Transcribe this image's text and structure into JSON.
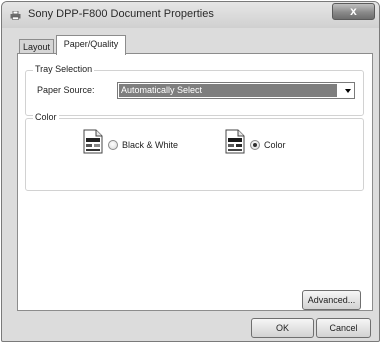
{
  "window": {
    "title": "Sony DPP-F800 Document Properties",
    "close_glyph": "x",
    "app_icon": "printer-icon"
  },
  "tabs": [
    {
      "label": "Layout",
      "selected": false
    },
    {
      "label": "Paper/Quality",
      "selected": true
    }
  ],
  "tray": {
    "group_title": "Tray Selection",
    "source_label": "Paper Source:",
    "source_value": "Automatically Select"
  },
  "color": {
    "group_title": "Color",
    "options": [
      {
        "label": "Black & White",
        "selected": false,
        "icon": "bw-document-icon"
      },
      {
        "label": "Color",
        "selected": true,
        "icon": "color-document-icon"
      }
    ]
  },
  "buttons": {
    "advanced": "Advanced...",
    "ok": "OK",
    "cancel": "Cancel"
  },
  "colors": {
    "selection_fill": "#7e7e7e",
    "window_bg": "#dcdcdc",
    "panel_bg": "#ffffff"
  }
}
